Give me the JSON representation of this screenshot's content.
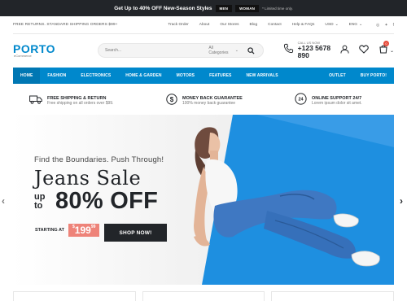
{
  "promo": {
    "text_before": "Get Up to ",
    "highlight": "40% OFF",
    "text_after": " New-Season Styles",
    "pill_men": "MEN",
    "pill_women": "WOMAN",
    "note": "* Limited time only."
  },
  "utility": {
    "shipping": "FREE RETURNS. STANDARD SHIPPING ORDERS $99+",
    "links": [
      "Track Order",
      "About",
      "Our Stores",
      "Blog",
      "Contact",
      "Help & FAQs"
    ],
    "currency": "USD",
    "language": "ENG"
  },
  "header": {
    "logo": "PORTO",
    "logo_sub": "eCommerce",
    "search_placeholder": "Search...",
    "search_category": "All Categories",
    "call_label": "CALL US NOW",
    "phone": "+123 5678 890",
    "cart_count": "0"
  },
  "nav": {
    "items": [
      "HOME",
      "FASHION",
      "ELECTRONICS",
      "HOME & GARDEN",
      "MOTORS",
      "FEATURES",
      "NEW ARRIVALS"
    ],
    "right": [
      "OUTLET",
      "BUY PORTO!"
    ]
  },
  "info": [
    {
      "title": "FREE SHIPPING & RETURN",
      "sub": "Free shipping on all orders over $99."
    },
    {
      "title": "MONEY BACK GUARANTEE",
      "sub": "100% money back guarantee"
    },
    {
      "title": "ONLINE SUPPORT 24/7",
      "sub": "Lorem ipsum dolor sit amet."
    }
  ],
  "hero": {
    "tagline": "Find the Boundaries. Push Through!",
    "title": "Jeans Sale",
    "upto": "up to",
    "discount": "80% OFF",
    "starting": "STARTING AT",
    "price_sup": "$",
    "price": "199",
    "price_cents": "99",
    "cta": "SHOP NOW!"
  },
  "colors": {
    "brand": "#0088cc",
    "dark": "#222529",
    "price_badge": "#ee8379",
    "hero_blue": "#1e8fe0"
  }
}
